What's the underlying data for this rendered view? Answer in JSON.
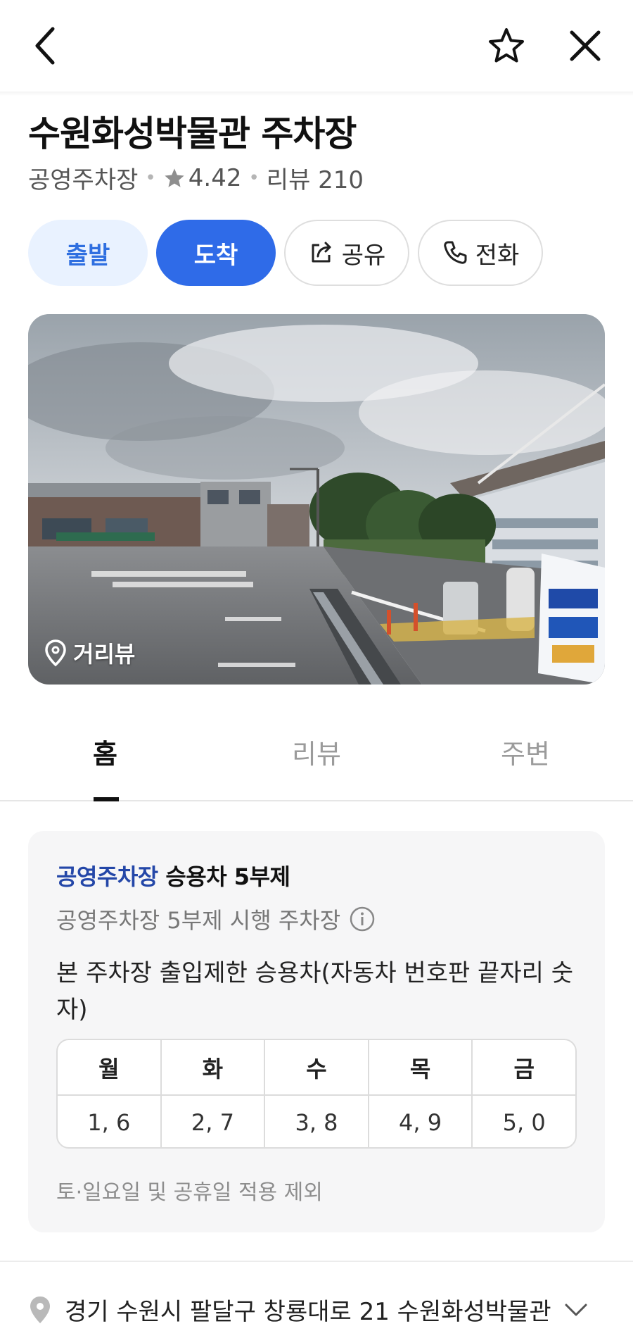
{
  "place": {
    "title": "수원화성박물관 주차장",
    "category": "공영주차장",
    "rating": "4.42",
    "reviews": "리뷰 210"
  },
  "actions": {
    "depart": "출발",
    "arrive": "도착",
    "share": "공유",
    "call": "전화"
  },
  "photo": {
    "streetview_label": "거리뷰"
  },
  "tabs": {
    "home": "홈",
    "review": "리뷰",
    "nearby": "주변"
  },
  "notice": {
    "title_highlight": "공영주차장",
    "title_rest": " 승용차 5부제",
    "subtitle": "공영주차장 5부제 시행 주차장",
    "description": "본 주차장 출입제한 승용차(자동차 번호판 끝자리 숫자)",
    "days": [
      "월",
      "화",
      "수",
      "목",
      "금"
    ],
    "plates": [
      "1, 6",
      "2, 7",
      "3, 8",
      "4, 9",
      "5, 0"
    ],
    "note": "토·일요일 및 공휴일 적용 제외"
  },
  "address": {
    "text": "경기 수원시 팔달구 창룡대로 21 수원화성박물관"
  },
  "colors": {
    "primary": "#2f6be8",
    "primary_light": "#e9f2ff",
    "highlight_text": "#2447a8"
  }
}
